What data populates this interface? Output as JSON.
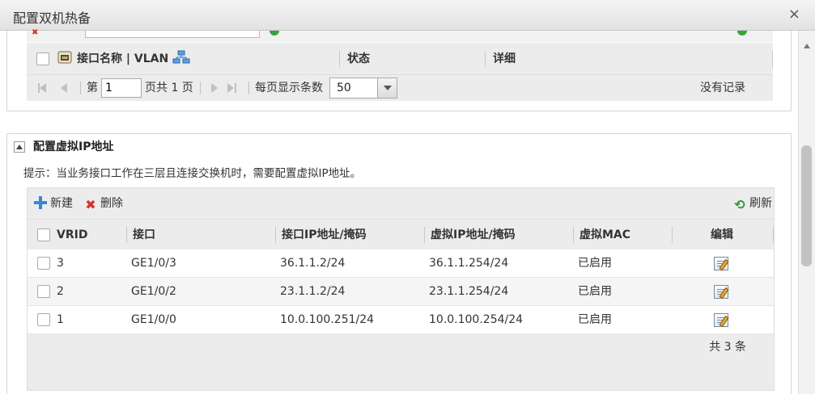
{
  "window": {
    "title": "配置双机热备",
    "close": "×"
  },
  "interface_table": {
    "columns": {
      "name": "接口名称 | VLAN",
      "status": "状态",
      "detail": "详细"
    },
    "pager": {
      "page_prefix": "第",
      "page_value": "1",
      "page_suffix": "页共 1 页",
      "page_size_label": "每页显示条数",
      "page_size_value": "50",
      "empty_text": "没有记录"
    }
  },
  "vip_panel": {
    "title": "配置虚拟IP地址",
    "hint": "提示：当业务接口工作在三层且连接交换机时，需要配置虚拟IP地址。",
    "toolbar": {
      "new_label": "新建",
      "delete_label": "删除",
      "refresh_label": "刷新"
    },
    "columns": {
      "vrid": "VRID",
      "interface": "接口",
      "ip": "接口IP地址/掩码",
      "vip": "虚拟IP地址/掩码",
      "vmac": "虚拟MAC",
      "edit": "编辑"
    },
    "rows": [
      {
        "vrid": "3",
        "interface": "GE1/0/3",
        "ip": "36.1.1.2/24",
        "vip": "36.1.1.254/24",
        "vmac": "已启用"
      },
      {
        "vrid": "2",
        "interface": "GE1/0/2",
        "ip": "23.1.1.2/24",
        "vip": "23.1.1.254/24",
        "vmac": "已启用"
      },
      {
        "vrid": "1",
        "interface": "GE1/0/0",
        "ip": "10.0.100.251/24",
        "vip": "10.0.100.254/24",
        "vmac": "已启用"
      }
    ],
    "total": "共 3 条"
  },
  "icons": {
    "close": "close-icon",
    "collapse": "collapse-up-icon",
    "new": "plus-icon",
    "delete": "delete-x-icon",
    "refresh": "refresh-icon",
    "edit": "edit-icon",
    "interface": "port-icon",
    "vlan": "network-icon"
  }
}
